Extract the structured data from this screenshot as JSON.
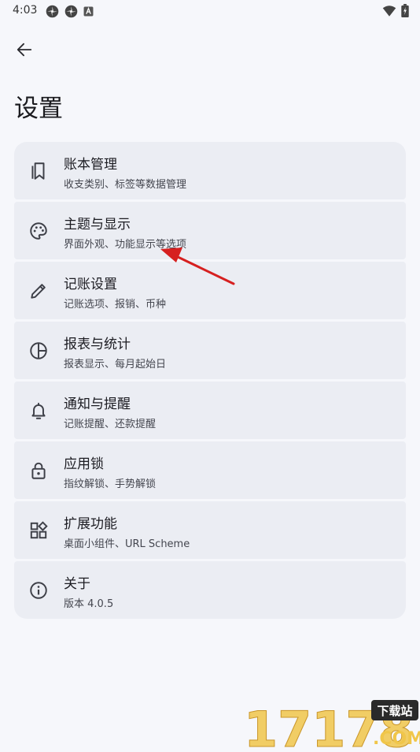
{
  "status_bar": {
    "time": "4:03",
    "left_icons": [
      "pinwheel-icon",
      "pinwheel-icon",
      "app-a-icon"
    ],
    "right_icons": [
      "wifi-icon",
      "battery-icon"
    ]
  },
  "header": {
    "back_icon": "arrow-left-icon",
    "title": "设置"
  },
  "settings": [
    {
      "icon": "book-icon",
      "title": "账本管理",
      "subtitle": "收支类别、标签等数据管理"
    },
    {
      "icon": "palette-icon",
      "title": "主题与显示",
      "subtitle": "界面外观、功能显示等选项"
    },
    {
      "icon": "pencil-icon",
      "title": "记账设置",
      "subtitle": "记账选项、报销、币种"
    },
    {
      "icon": "pie-chart-icon",
      "title": "报表与统计",
      "subtitle": "报表显示、每月起始日"
    },
    {
      "icon": "bell-icon",
      "title": "通知与提醒",
      "subtitle": "记账提醒、还款提醒"
    },
    {
      "icon": "lock-icon",
      "title": "应用锁",
      "subtitle": "指纹解锁、手势解锁"
    },
    {
      "icon": "widgets-icon",
      "title": "扩展功能",
      "subtitle": "桌面小组件、URL Scheme"
    },
    {
      "icon": "info-icon",
      "title": "关于",
      "subtitle": "版本 4.0.5"
    }
  ],
  "annotation": {
    "color": "#d62020"
  },
  "watermark": {
    "number": "17178",
    "badge": "下载站",
    "domain": ".COM"
  },
  "colors": {
    "background": "#f6f7fb",
    "card": "#ebedf3",
    "icon": "#3d3f47",
    "watermark_gold": "#f0c64a"
  }
}
